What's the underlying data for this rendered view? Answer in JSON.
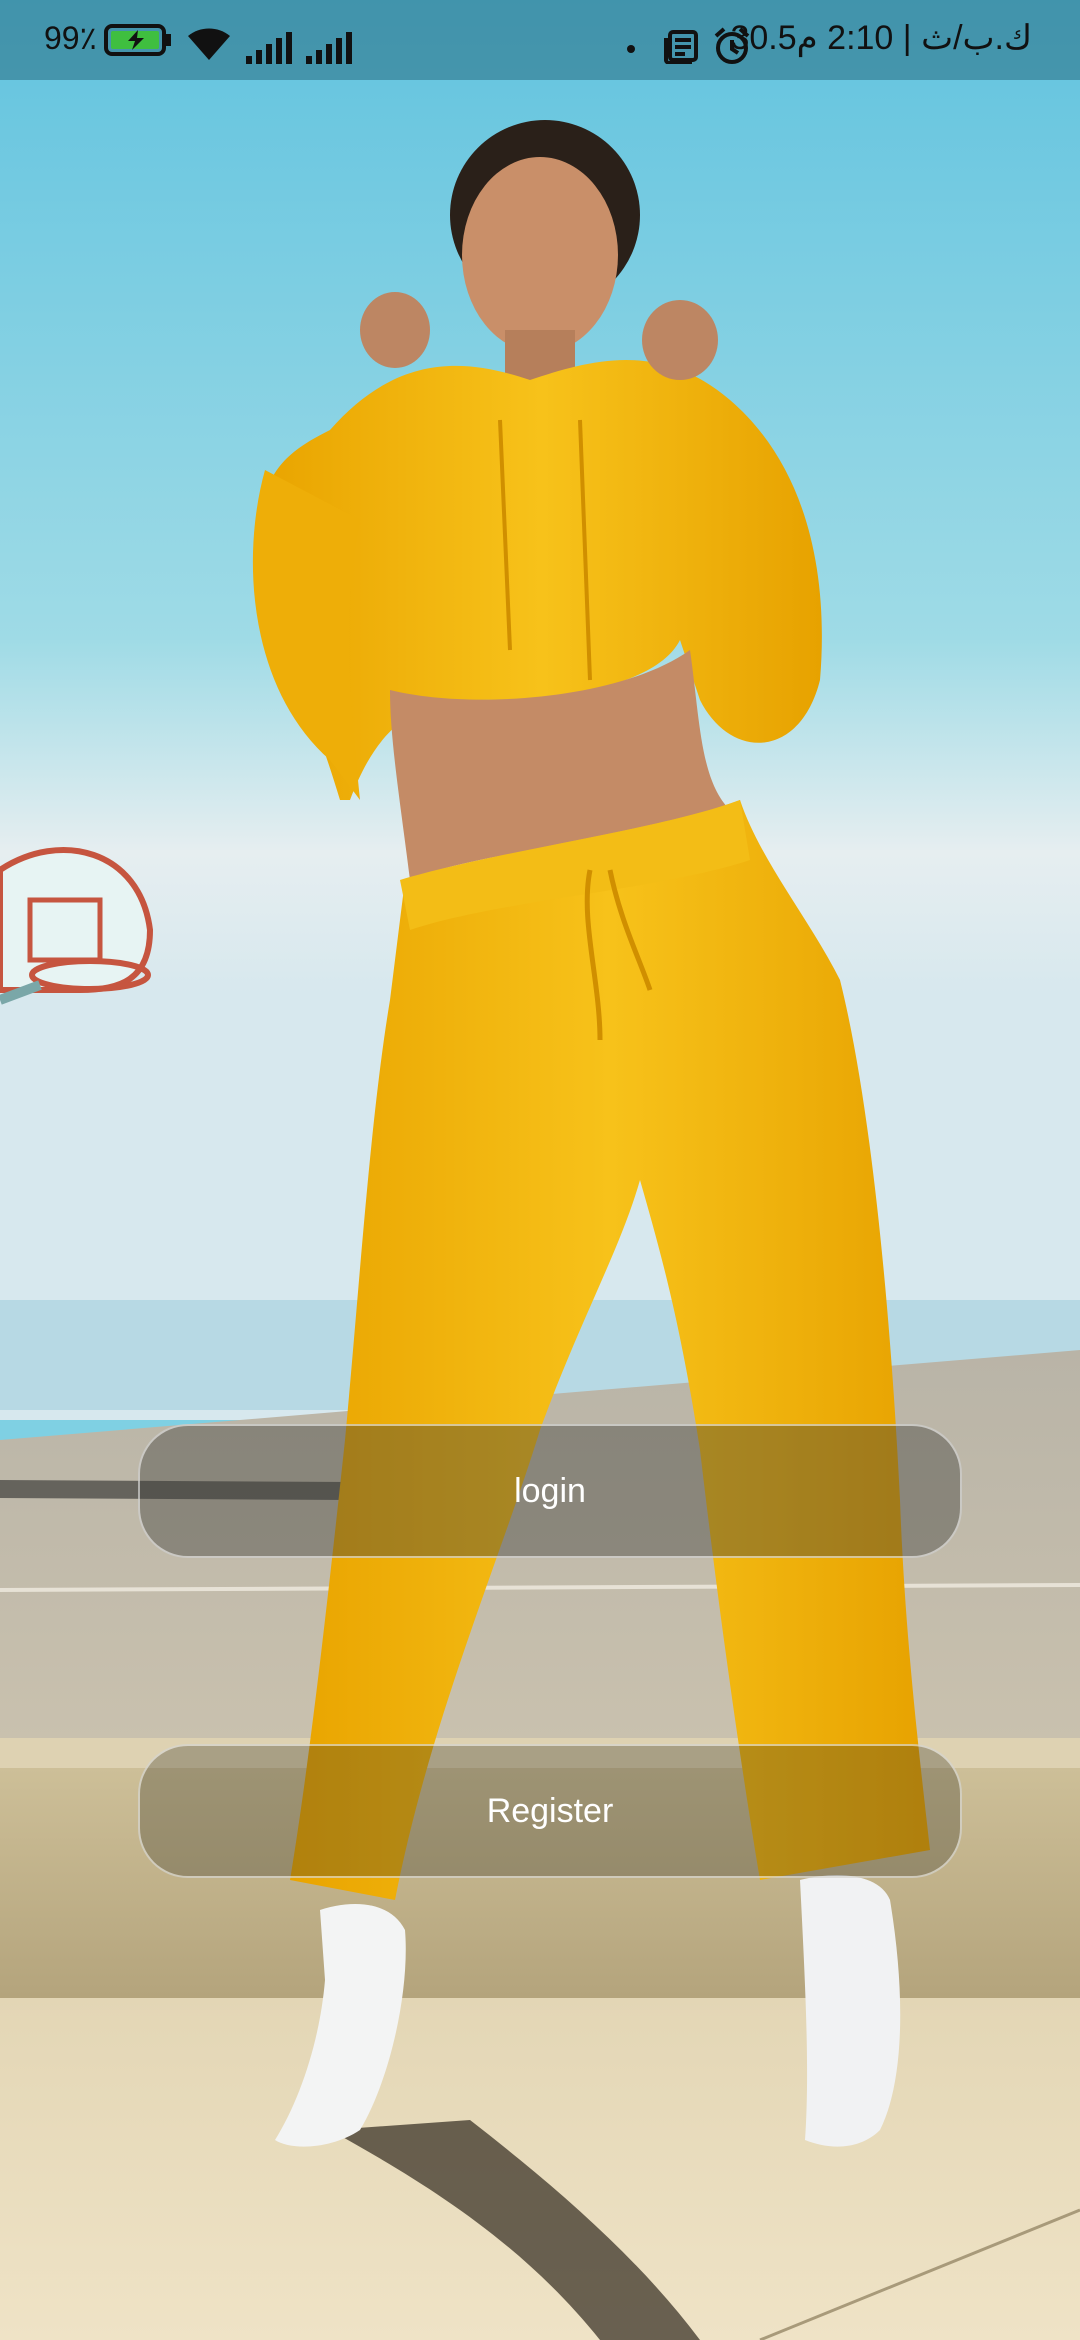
{
  "status_bar": {
    "battery_percent": "99٪",
    "right_text": "30.5ك.ب/ث | 2:10 م",
    "icons": [
      "battery-charging-icon",
      "wifi-icon",
      "signal-icon",
      "signal-icon",
      "dot-icon",
      "news-icon",
      "alarm-icon"
    ]
  },
  "actions": {
    "login_label": "login",
    "register_label": "Register"
  },
  "colors": {
    "sky_top": "#6cc8e2",
    "outfit_yellow": "#f2b600",
    "button_text": "#ffffff"
  }
}
